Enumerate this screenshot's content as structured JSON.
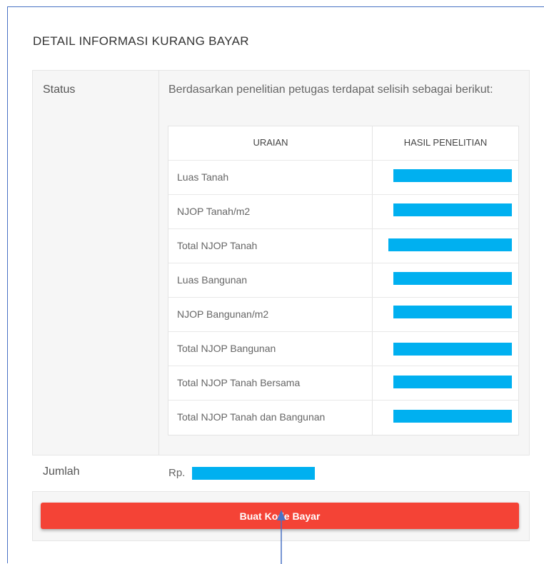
{
  "page": {
    "title": "DETAIL INFORMASI KURANG BAYAR"
  },
  "status": {
    "label": "Status",
    "description": "Berdasarkan penelitian petugas terdapat selisih sebagai berikut:"
  },
  "table": {
    "headers": [
      "URAIAN",
      "HASIL PENELITIAN"
    ],
    "rows": [
      {
        "label": "Luas Tanah"
      },
      {
        "label": "NJOP Tanah/m2"
      },
      {
        "label": "Total NJOP Tanah"
      },
      {
        "label": "Luas Bangunan"
      },
      {
        "label": "NJOP Bangunan/m2"
      },
      {
        "label": "Total NJOP Bangunan"
      },
      {
        "label": "Total NJOP Tanah Bersama"
      },
      {
        "label": "Total NJOP Tanah dan Bangunan"
      }
    ]
  },
  "jumlah": {
    "label": "Jumlah",
    "prefix": "Rp."
  },
  "actions": {
    "pay_button_label": "Buat Kode Bayar"
  },
  "colors": {
    "accent_button": "#f44336",
    "redaction": "#00b0f0",
    "annotation": "#4a72c4"
  }
}
